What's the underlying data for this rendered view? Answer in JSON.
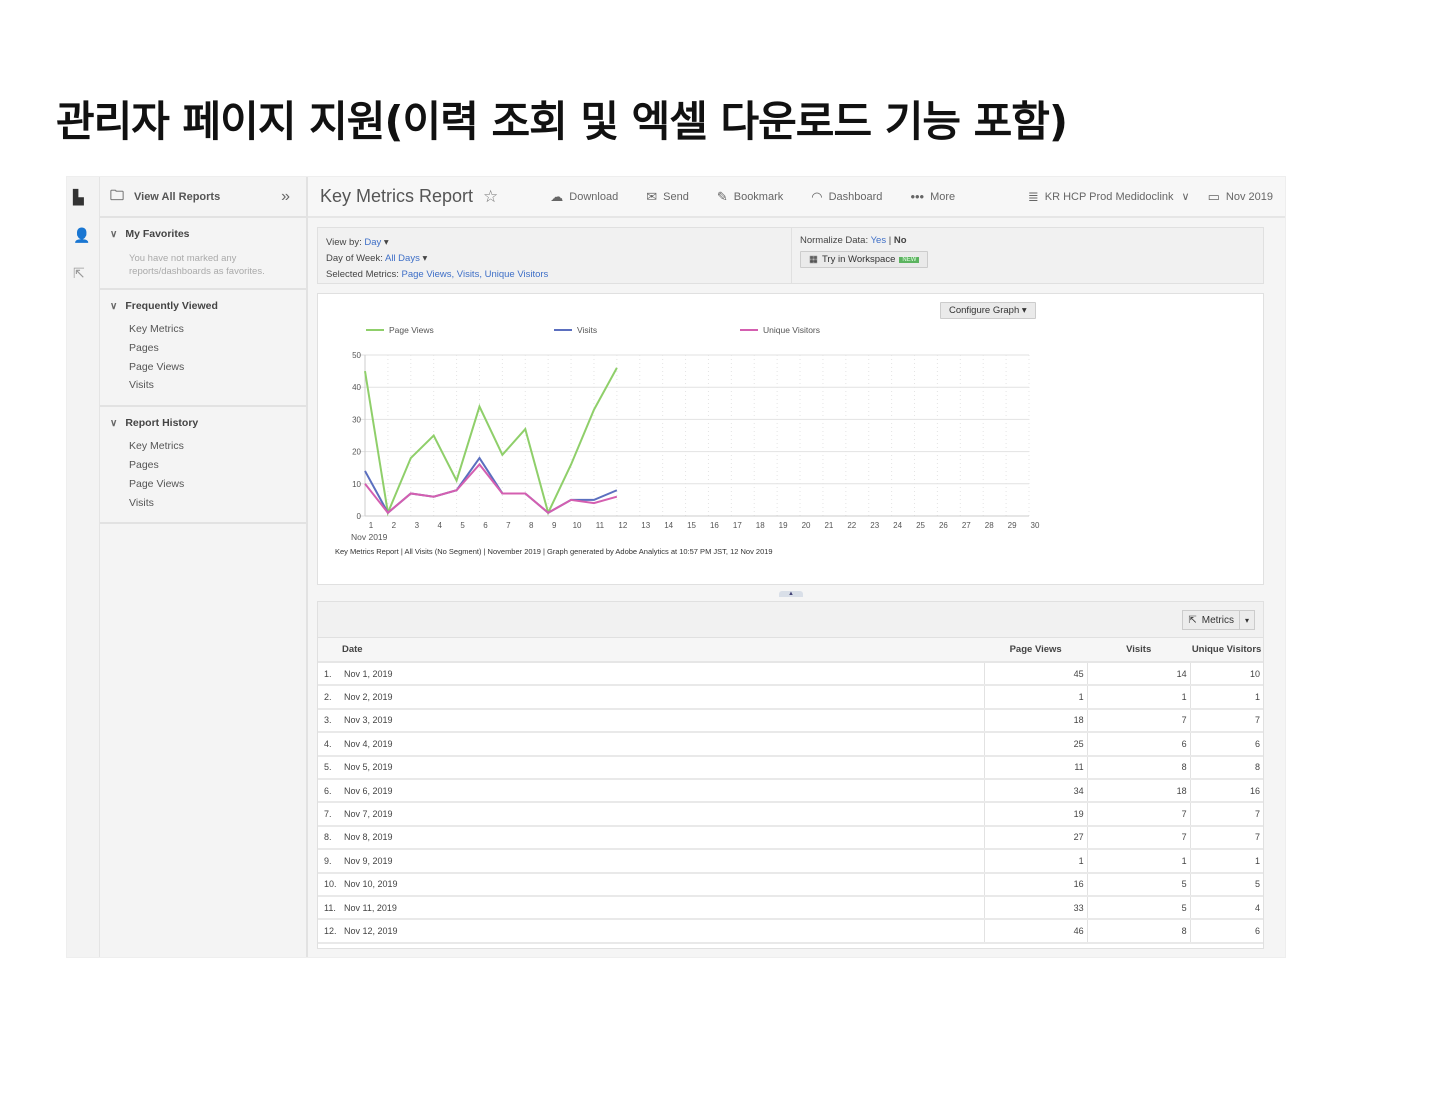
{
  "slide_title": "관리자 페이지 지원(이력 조회 및 엑셀 다운로드 기능 포함)",
  "sidebar": {
    "view_all": "View All Reports",
    "favorites": {
      "title": "My Favorites",
      "note": "You have not marked any reports/dashboards as favorites."
    },
    "frequent": {
      "title": "Frequently Viewed",
      "items": [
        "Key Metrics",
        "Pages",
        "Page Views",
        "Visits"
      ]
    },
    "history": {
      "title": "Report History",
      "items": [
        "Key Metrics",
        "Pages",
        "Page Views",
        "Visits"
      ]
    }
  },
  "header": {
    "title": "Key Metrics Report",
    "download": "Download",
    "send": "Send",
    "bookmark": "Bookmark",
    "dashboard": "Dashboard",
    "more": "More",
    "suite": "KR HCP Prod Medidoclink",
    "date": "Nov 2019"
  },
  "options": {
    "view_by_label": "View by:",
    "view_by": "Day",
    "dow_label": "Day of Week:",
    "dow": "All Days",
    "metrics_label": "Selected Metrics:",
    "metrics": "Page Views, Visits, Unique Visitors",
    "normalize_label": "Normalize Data:",
    "yes": "Yes",
    "sep": "|",
    "no": "No",
    "workspace": "Try in Workspace",
    "new_badge": "NEW"
  },
  "chart_data": {
    "type": "line",
    "configure": "Configure Graph",
    "x_sublabel": "Nov 2019",
    "categories": [
      "1",
      "2",
      "3",
      "4",
      "5",
      "6",
      "7",
      "8",
      "9",
      "10",
      "11",
      "12",
      "13",
      "14",
      "15",
      "16",
      "17",
      "18",
      "19",
      "20",
      "21",
      "22",
      "23",
      "24",
      "25",
      "26",
      "27",
      "28",
      "29",
      "30"
    ],
    "yticks": [
      "0",
      "10",
      "20",
      "30",
      "40",
      "50"
    ],
    "ylim": [
      0,
      50
    ],
    "grid": true,
    "legend": "top",
    "series": [
      {
        "name": "Page Views",
        "color": "#8fcf6a",
        "values": [
          45,
          1,
          18,
          25,
          11,
          34,
          19,
          27,
          1,
          16,
          33,
          46
        ]
      },
      {
        "name": "Visits",
        "color": "#5b6fbf",
        "values": [
          14,
          1,
          7,
          6,
          8,
          18,
          7,
          7,
          1,
          5,
          5,
          8
        ]
      },
      {
        "name": "Unique Visitors",
        "color": "#d45fb0",
        "values": [
          10,
          1,
          7,
          6,
          8,
          16,
          7,
          7,
          1,
          5,
          4,
          6
        ]
      }
    ],
    "footnote": "Key Metrics Report | All Visits (No Segment) | November 2019 | Graph generated by Adobe Analytics at 10:57 PM JST, 12 Nov 2019"
  },
  "table": {
    "metrics_button": "Metrics",
    "headers": [
      "Date",
      "Page Views",
      "Visits",
      "Unique Visitors"
    ],
    "rows": [
      [
        "1.",
        "Nov 1, 2019",
        "45",
        "14",
        "10"
      ],
      [
        "2.",
        "Nov 2, 2019",
        "1",
        "1",
        "1"
      ],
      [
        "3.",
        "Nov 3, 2019",
        "18",
        "7",
        "7"
      ],
      [
        "4.",
        "Nov 4, 2019",
        "25",
        "6",
        "6"
      ],
      [
        "5.",
        "Nov 5, 2019",
        "11",
        "8",
        "8"
      ],
      [
        "6.",
        "Nov 6, 2019",
        "34",
        "18",
        "16"
      ],
      [
        "7.",
        "Nov 7, 2019",
        "19",
        "7",
        "7"
      ],
      [
        "8.",
        "Nov 8, 2019",
        "27",
        "7",
        "7"
      ],
      [
        "9.",
        "Nov 9, 2019",
        "1",
        "1",
        "1"
      ],
      [
        "10.",
        "Nov 10, 2019",
        "16",
        "5",
        "5"
      ],
      [
        "11.",
        "Nov 11, 2019",
        "33",
        "5",
        "4"
      ],
      [
        "12.",
        "Nov 12, 2019",
        "46",
        "8",
        "6"
      ]
    ]
  }
}
